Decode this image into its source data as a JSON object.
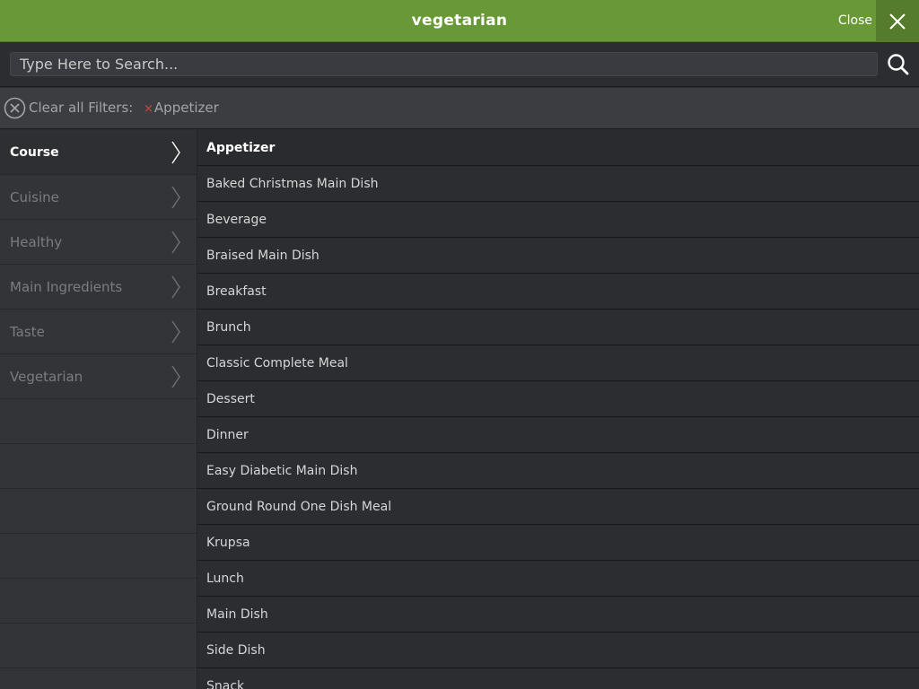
{
  "header": {
    "title": "vegetarian",
    "close_label": "Close"
  },
  "search": {
    "placeholder": "Type Here to Search...",
    "value": ""
  },
  "filters": {
    "clear_label": "Clear all Filters:",
    "active": [
      {
        "label": "Appetizer",
        "remove_glyph": "×"
      }
    ]
  },
  "sidebar": {
    "items": [
      {
        "label": "Course",
        "active": true
      },
      {
        "label": "Cuisine",
        "active": false
      },
      {
        "label": "Healthy",
        "active": false
      },
      {
        "label": "Main Ingredients",
        "active": false
      },
      {
        "label": "Taste",
        "active": false
      },
      {
        "label": "Vegetarian",
        "active": false
      }
    ]
  },
  "list": {
    "header": "Appetizer",
    "items": [
      "Baked Christmas Main Dish",
      "Beverage",
      "Braised Main Dish",
      "Breakfast",
      "Brunch",
      "Classic Complete Meal",
      "Dessert",
      "Dinner",
      "Easy Diabetic Main Dish",
      "Ground Round One Dish Meal",
      "Krupsa",
      "Lunch",
      "Main Dish",
      "Side Dish",
      "Snack"
    ]
  },
  "icons": {
    "close": "close-icon",
    "search": "search-icon",
    "clear": "circle-x-icon",
    "chevron": "chevron-right-icon"
  },
  "colors": {
    "header_green": "#699936",
    "close_button": "#557c2d",
    "remove_x": "#d9433a"
  }
}
